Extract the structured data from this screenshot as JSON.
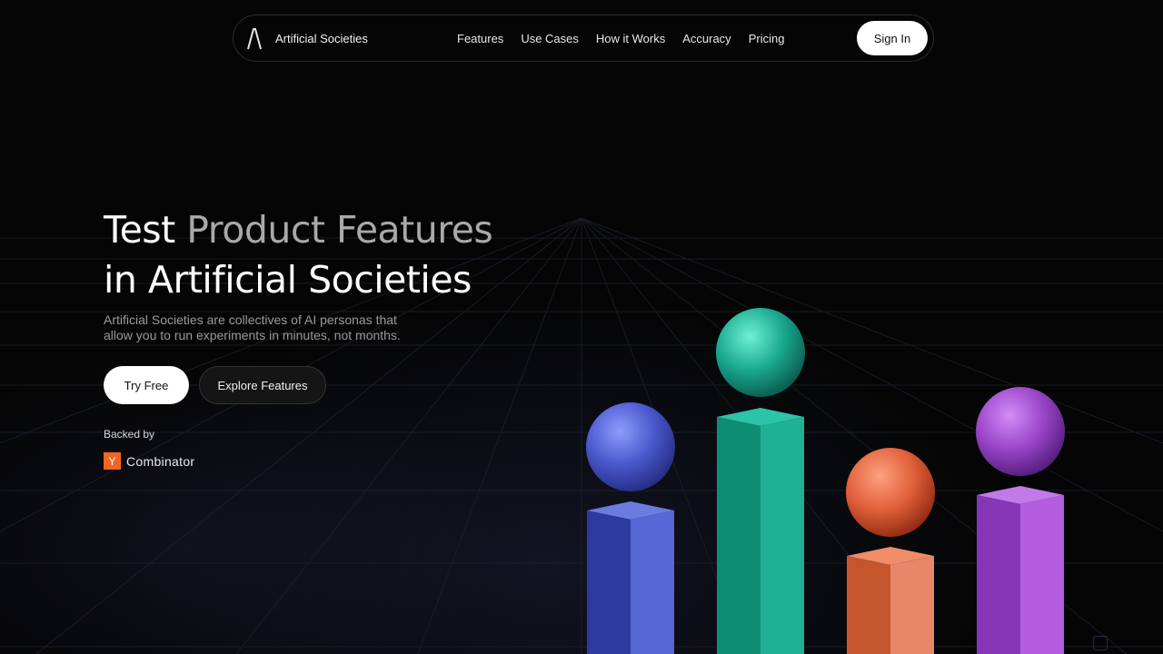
{
  "nav": {
    "brand": "Artificial Societies",
    "links": [
      "Features",
      "Use Cases",
      "How it Works",
      "Accuracy",
      "Pricing"
    ],
    "sign_in": "Sign In"
  },
  "hero": {
    "title_part1": "Test ",
    "title_part2": "Product Features",
    "title_line2": "in Artificial Societies",
    "subtitle_line1": "Artificial Societies are collectives of AI personas that",
    "subtitle_line2": "allow you to run experiments in minutes, not months.",
    "primary_button": "Try Free",
    "secondary_button": "Explore Features",
    "backed_label": "Backed by",
    "backer_logo_letter": "Y",
    "backer_name": "Combinator"
  },
  "colors": {
    "background": "#050505",
    "yc_orange": "#f26522",
    "blue": "#4f5fd0",
    "teal": "#1aa58f",
    "orange": "#e0603a",
    "purple": "#9a45c8"
  },
  "illustration": {
    "pillars": [
      {
        "color": "blue",
        "icon": "sphere-on-pillar"
      },
      {
        "color": "teal",
        "icon": "sphere-on-pillar"
      },
      {
        "color": "orange",
        "icon": "sphere-on-pillar"
      },
      {
        "color": "purple",
        "icon": "sphere-on-pillar"
      }
    ]
  }
}
